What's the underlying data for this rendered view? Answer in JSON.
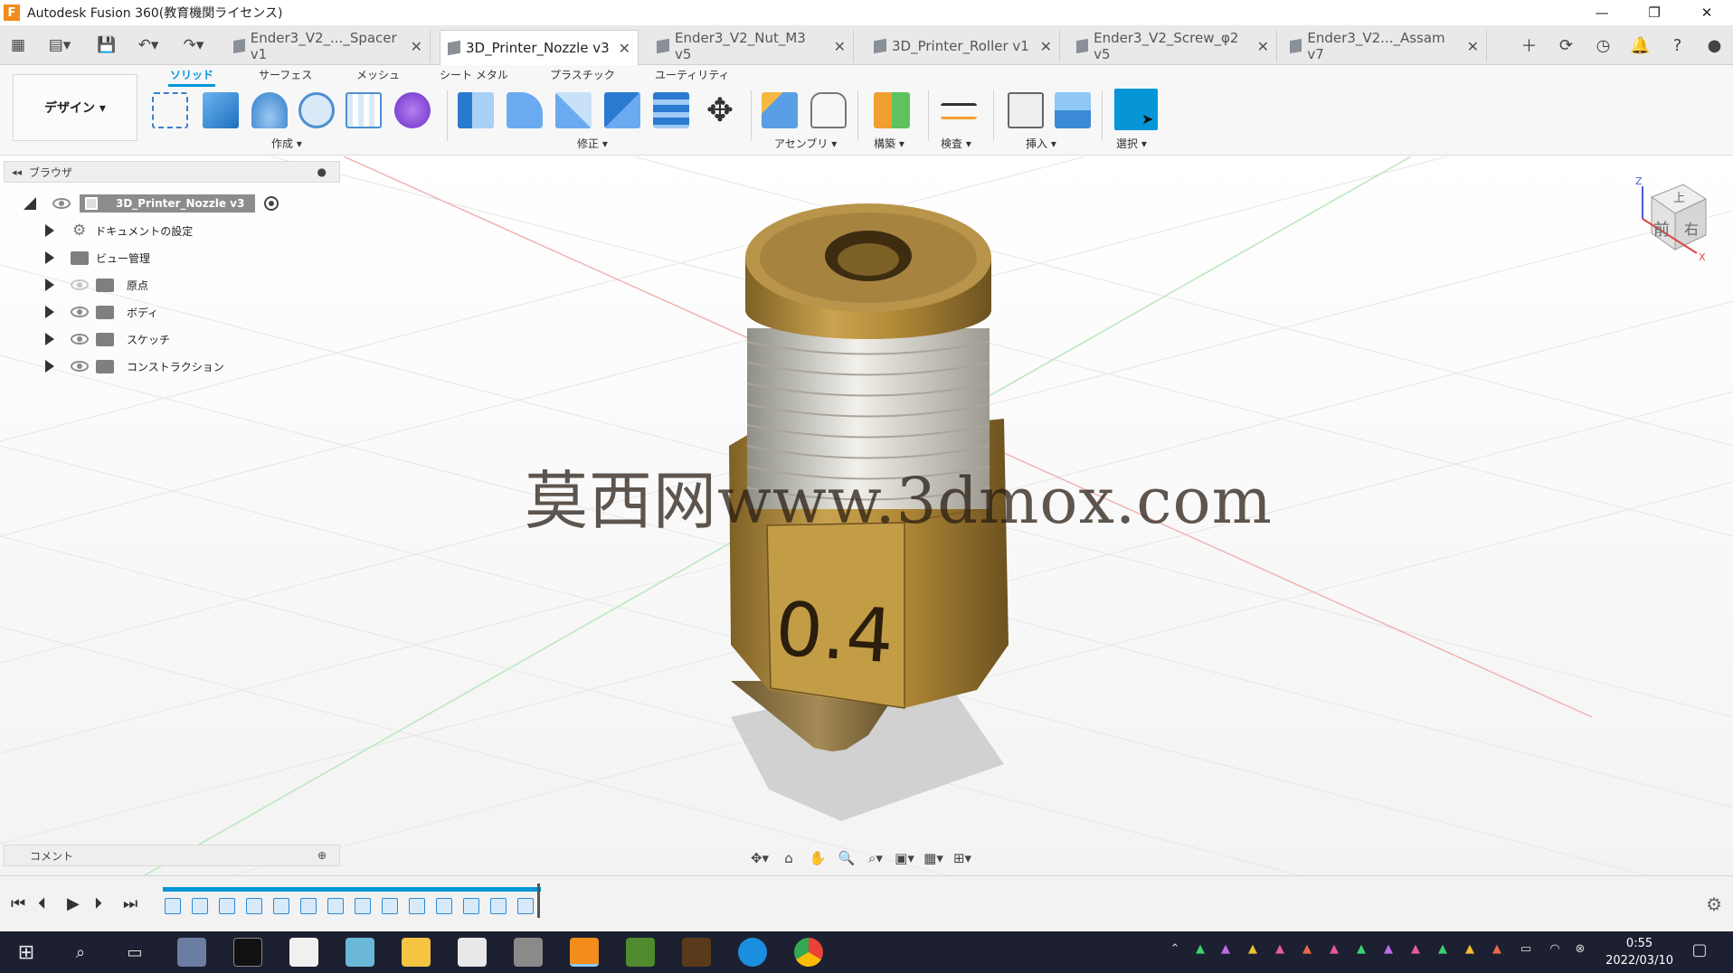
{
  "window": {
    "app_icon": "F",
    "title": "Autodesk Fusion 360(教育機関ライセンス)",
    "minimize": "—",
    "maximize": "❐",
    "close": "✕"
  },
  "tabs": [
    {
      "label": "Ender3_V2_..._Spacer v1"
    },
    {
      "label": "3D_Printer_Nozzle v3"
    },
    {
      "label": "Ender3_V2_Nut_M3 v5"
    },
    {
      "label": "3D_Printer_Roller v1"
    },
    {
      "label": "Ender3_V2_Screw_φ2 v5"
    },
    {
      "label": "Ender3_V2..._Assam v7"
    }
  ],
  "toolbar": {
    "workspace": "デザイン ▾",
    "tabs": [
      "ソリッド",
      "サーフェス",
      "メッシュ",
      "シート メタル",
      "プラスチック",
      "ユーティリティ"
    ],
    "groups": {
      "create": "作成 ▾",
      "modify": "修正 ▾",
      "assemble": "アセンブリ ▾",
      "construct": "構築 ▾",
      "inspect": "検査 ▾",
      "insert": "挿入 ▾",
      "select": "選択 ▾"
    }
  },
  "browser": {
    "title": "ブラウザ",
    "root": "3D_Printer_Nozzle v3",
    "items": [
      {
        "label": "ドキュメントの設定"
      },
      {
        "label": "ビュー管理"
      },
      {
        "label": "原点"
      },
      {
        "label": "ボディ"
      },
      {
        "label": "スケッチ"
      },
      {
        "label": "コンストラクション"
      }
    ]
  },
  "comments": {
    "title": "コメント"
  },
  "model": {
    "engraving": "0.4"
  },
  "watermark": "莫西网www.3dmox.com",
  "viewcube": {
    "top": "上",
    "front": "前",
    "right": "右",
    "axis_z": "Z",
    "axis_x": "X"
  },
  "taskbar": {
    "time": "0:55",
    "date": "2022/03/10"
  },
  "colors": {
    "accent": "#0696d7",
    "brass": "#b5913f",
    "taskbar": "#1c2030"
  }
}
